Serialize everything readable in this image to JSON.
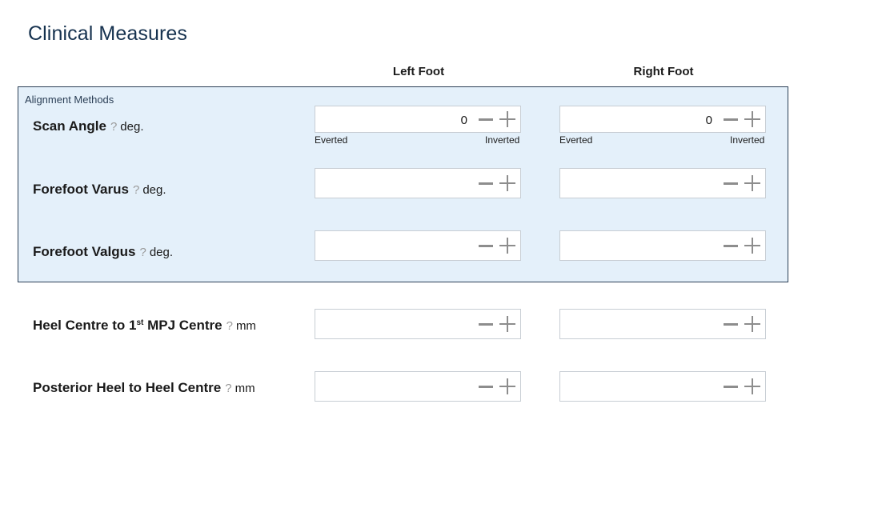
{
  "page": {
    "title": "Clinical Measures"
  },
  "columns": {
    "left": "Left Foot",
    "right": "Right Foot"
  },
  "alignment_group": {
    "title": "Alignment Methods"
  },
  "rows": {
    "scan_angle": {
      "label": "Scan Angle",
      "help": "?",
      "unit": "deg.",
      "left_value": "0",
      "right_value": "0",
      "min_hint": "Everted",
      "max_hint": "Inverted"
    },
    "forefoot_varus": {
      "label": "Forefoot Varus",
      "help": "?",
      "unit": "deg.",
      "left_value": "",
      "right_value": ""
    },
    "forefoot_valgus": {
      "label": "Forefoot Valgus",
      "help": "?",
      "unit": "deg.",
      "left_value": "",
      "right_value": ""
    },
    "heel_to_mpj": {
      "label_pre": "Heel Centre to 1",
      "label_sup": "st",
      "label_post": " MPJ Centre",
      "help": "?",
      "unit": "mm",
      "left_value": "",
      "right_value": ""
    },
    "posterior_heel": {
      "label": "Posterior Heel to Heel Centre",
      "help": "?",
      "unit": "mm",
      "left_value": "",
      "right_value": ""
    }
  },
  "icons": {
    "decrement": "minus-icon",
    "increment": "plus-icon"
  },
  "colors": {
    "title": "#16324f",
    "group_background": "#e4f0fa",
    "group_border": "#2b3f56",
    "field_border": "#c7cdd3",
    "stepper_icon": "#8d8d8d",
    "help_icon": "#9a9a9a"
  }
}
